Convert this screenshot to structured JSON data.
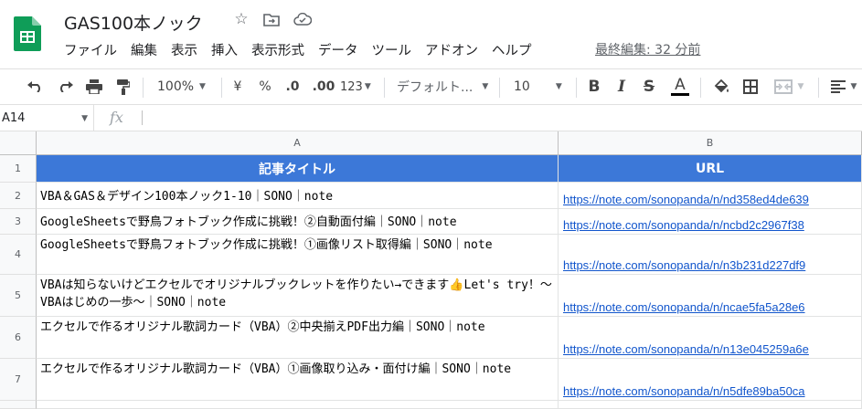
{
  "app": {
    "title": "GAS100本ノック",
    "last_edit": "最終編集: 32 分前",
    "menu": [
      "ファイル",
      "編集",
      "表示",
      "挿入",
      "表示形式",
      "データ",
      "ツール",
      "アドオン",
      "ヘルプ"
    ]
  },
  "toolbar": {
    "zoom": "100%",
    "currency": "¥",
    "percent": "%",
    "decimal_decrease": ".0",
    "decimal_increase": ".00",
    "number_format": "123",
    "font": "デフォルト...",
    "font_size": "10",
    "bold": "B",
    "italic": "I",
    "strikethrough": "S",
    "text_color": "A"
  },
  "formula": {
    "name_box": "A14",
    "fx": "fx",
    "value": ""
  },
  "grid": {
    "columns": [
      "A",
      "B"
    ],
    "rows": [
      {
        "num": "1",
        "a": "記事タイトル",
        "b": "URL"
      },
      {
        "num": "2",
        "a": "VBA＆GAS＆デザイン100本ノック1-10｜SONO｜note",
        "b": "https://note.com/sonopanda/n/nd358ed4de639"
      },
      {
        "num": "3",
        "a": "GoogleSheetsで野鳥フォトブック作成に挑戦！②自動面付編｜SONO｜note",
        "b": "https://note.com/sonopanda/n/ncbd2c2967f38"
      },
      {
        "num": "4",
        "a": "GoogleSheetsで野鳥フォトブック作成に挑戦！①画像リスト取得編｜SONO｜note",
        "b": "https://note.com/sonopanda/n/n3b231d227df9"
      },
      {
        "num": "5",
        "a": "VBAは知らないけどエクセルでオリジナルブックレットを作りたい→できます👍Let's try！～VBAはじめの一歩～｜SONO｜note",
        "b": "https://note.com/sonopanda/n/ncae5fa5a28e6"
      },
      {
        "num": "6",
        "a": "エクセルで作るオリジナル歌詞カード（VBA）②中央揃えPDF出力編｜SONO｜note",
        "b": "https://note.com/sonopanda/n/n13e045259a6e"
      },
      {
        "num": "7",
        "a": "エクセルで作るオリジナル歌詞カード（VBA）①画像取り込み・面付け編｜SONO｜note",
        "b": "https://note.com/sonopanda/n/n5dfe89ba50ca"
      }
    ]
  },
  "colors": {
    "header_fill": "#3c78d8",
    "link": "#1155cc",
    "logo": "#0f9d58"
  }
}
